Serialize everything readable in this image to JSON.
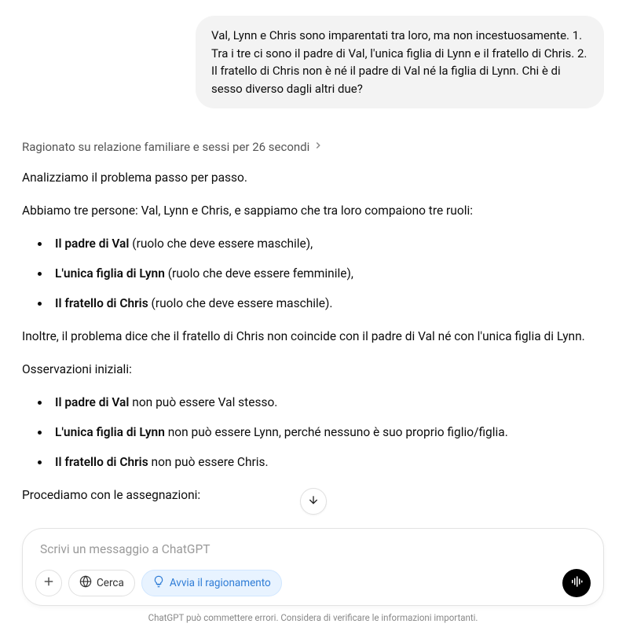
{
  "user_message": "Val, Lynn e Chris sono imparentati tra loro, ma non incestuosamente. 1. Tra i tre ci sono il padre di Val, l'unica figlia di Lynn e il fratello di Chris. 2. Il fratello di Chris non è né il padre di Val né la figlia di Lynn. Chi è di sesso diverso dagli altri due?",
  "reasoning_label": "Ragionato su relazione familiare e sessi per 26 secondi",
  "assistant": {
    "p1": "Analizziamo il problema passo per passo.",
    "p2": "Abbiamo tre persone: Val, Lynn e Chris, e sappiamo che tra loro compaiono tre ruoli:",
    "list1": {
      "i1_bold": "Il padre di Val",
      "i1_rest": " (ruolo che deve essere maschile),",
      "i2_bold": "L'unica figlia di Lynn",
      "i2_rest": " (ruolo che deve essere femminile),",
      "i3_bold": "Il fratello di Chris",
      "i3_rest": " (ruolo che deve essere maschile)."
    },
    "p3": "Inoltre, il problema dice che il fratello di Chris non coincide con il padre di Val né con l'unica figlia di Lynn.",
    "p4": "Osservazioni iniziali:",
    "list2": {
      "i1_bold": "Il padre di Val",
      "i1_rest": " non può essere Val stesso.",
      "i2_bold": "L'unica figlia di Lynn",
      "i2_rest": " non può essere Lynn, perché nessuno è suo proprio figlio/figlia.",
      "i3_bold": "Il fratello di Chris",
      "i3_rest": " non può essere Chris."
    },
    "p5": "Procediamo con le assegnazioni:"
  },
  "input": {
    "placeholder": "Scrivi un messaggio a ChatGPT",
    "search_label": "Cerca",
    "reasoning_btn_label": "Avvia il ragionamento"
  },
  "footer": "ChatGPT può commettere errori. Considera di verificare le informazioni importanti."
}
